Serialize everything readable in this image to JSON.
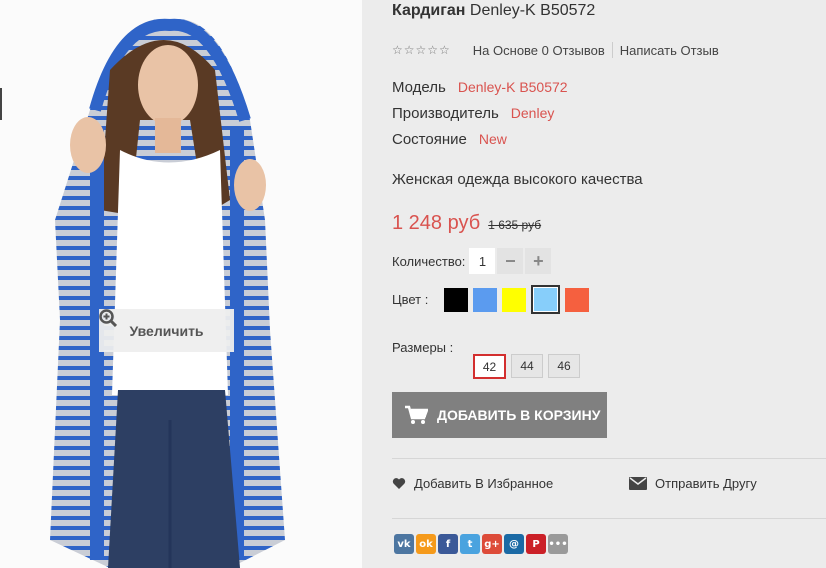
{
  "product": {
    "title_category": "Кардиган",
    "title_model": "Denley-K B50572",
    "rating_stars": "☆☆☆☆☆",
    "reviews_text": "На Основе 0 Отзывов",
    "write_review": "Написать Отзыв",
    "specs": [
      {
        "label": "Модель",
        "value": "Denley-K B50572"
      },
      {
        "label": "Производитель",
        "value": "Denley"
      },
      {
        "label": "Состояние",
        "value": "New"
      }
    ],
    "description": "Женская одежда высокого качества",
    "price": "1 248 руб",
    "old_price": "1 635 руб",
    "quantity_label": "Количество:",
    "quantity_value": "1",
    "qty_minus": "−",
    "qty_plus": "+",
    "color_label": "Цвет :",
    "colors": [
      "#000000",
      "#5b9bef",
      "#ffff00",
      "#87cefa",
      "#f5603f"
    ],
    "selected_color_index": 3,
    "sizes_label": "Размеры :",
    "sizes": [
      "42",
      "44",
      "46"
    ],
    "selected_size": "42",
    "add_to_cart": "ДОБАВИТЬ В КОРЗИНУ",
    "add_to_wishlist": "Добавить В Избранное",
    "send_to_friend": "Отправить Другу"
  },
  "image": {
    "zoom_label": "Увеличить"
  },
  "social": [
    {
      "name": "vk-icon",
      "label": "vk",
      "color": "#4d76a1"
    },
    {
      "name": "odnoklassniki-icon",
      "label": "ok",
      "color": "#f59a1b"
    },
    {
      "name": "facebook-icon",
      "label": "f",
      "color": "#3b5998"
    },
    {
      "name": "twitter-icon",
      "label": "t",
      "color": "#4aa3df"
    },
    {
      "name": "google-plus-icon",
      "label": "g+",
      "color": "#dd4b39"
    },
    {
      "name": "email-icon",
      "label": "@",
      "color": "#1b6aa5"
    },
    {
      "name": "pinterest-icon",
      "label": "P",
      "color": "#cb2027"
    },
    {
      "name": "more-icon",
      "label": "•••",
      "color": "#9a9a9a"
    }
  ]
}
